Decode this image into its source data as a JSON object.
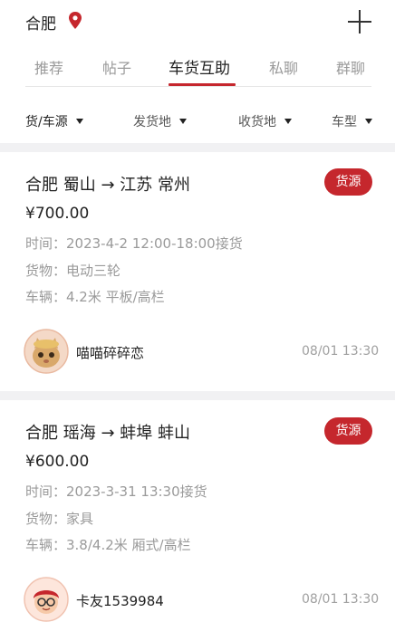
{
  "header": {
    "city": "合肥",
    "location_icon": "location-pin-icon",
    "add_icon": "plus-icon"
  },
  "tabs": [
    {
      "label": "推荐",
      "active": false
    },
    {
      "label": "帖子",
      "active": false
    },
    {
      "label": "车货互助",
      "active": true
    },
    {
      "label": "私聊",
      "active": false
    },
    {
      "label": "群聊",
      "active": false
    }
  ],
  "filters": [
    {
      "label": "货/车源"
    },
    {
      "label": "发货地"
    },
    {
      "label": "收货地"
    },
    {
      "label": "车型"
    }
  ],
  "posts": [
    {
      "route": "合肥 蜀山 → 江苏 常州",
      "badge": "货源",
      "price": "¥700.00",
      "time": "时间：2023-4-2 12:00-18:00接货",
      "goods": "货物：电动三轮",
      "vehicle": "车辆：4.2米 平板/高栏",
      "user": "喵喵碎碎恋",
      "posted": "08/01 13:30"
    },
    {
      "route": "合肥 瑶海 → 蚌埠 蚌山",
      "badge": "货源",
      "price": "¥600.00",
      "time": "时间：2023-3-31 13:30接货",
      "goods": "货物：家具",
      "vehicle": "车辆：3.8/4.2米 厢式/高栏",
      "user": "卡友1539984",
      "posted": "08/01 13:30"
    }
  ],
  "colors": {
    "accent": "#c5272d",
    "muted_text": "#9a9a9a",
    "separator": "#f1f1f3"
  }
}
